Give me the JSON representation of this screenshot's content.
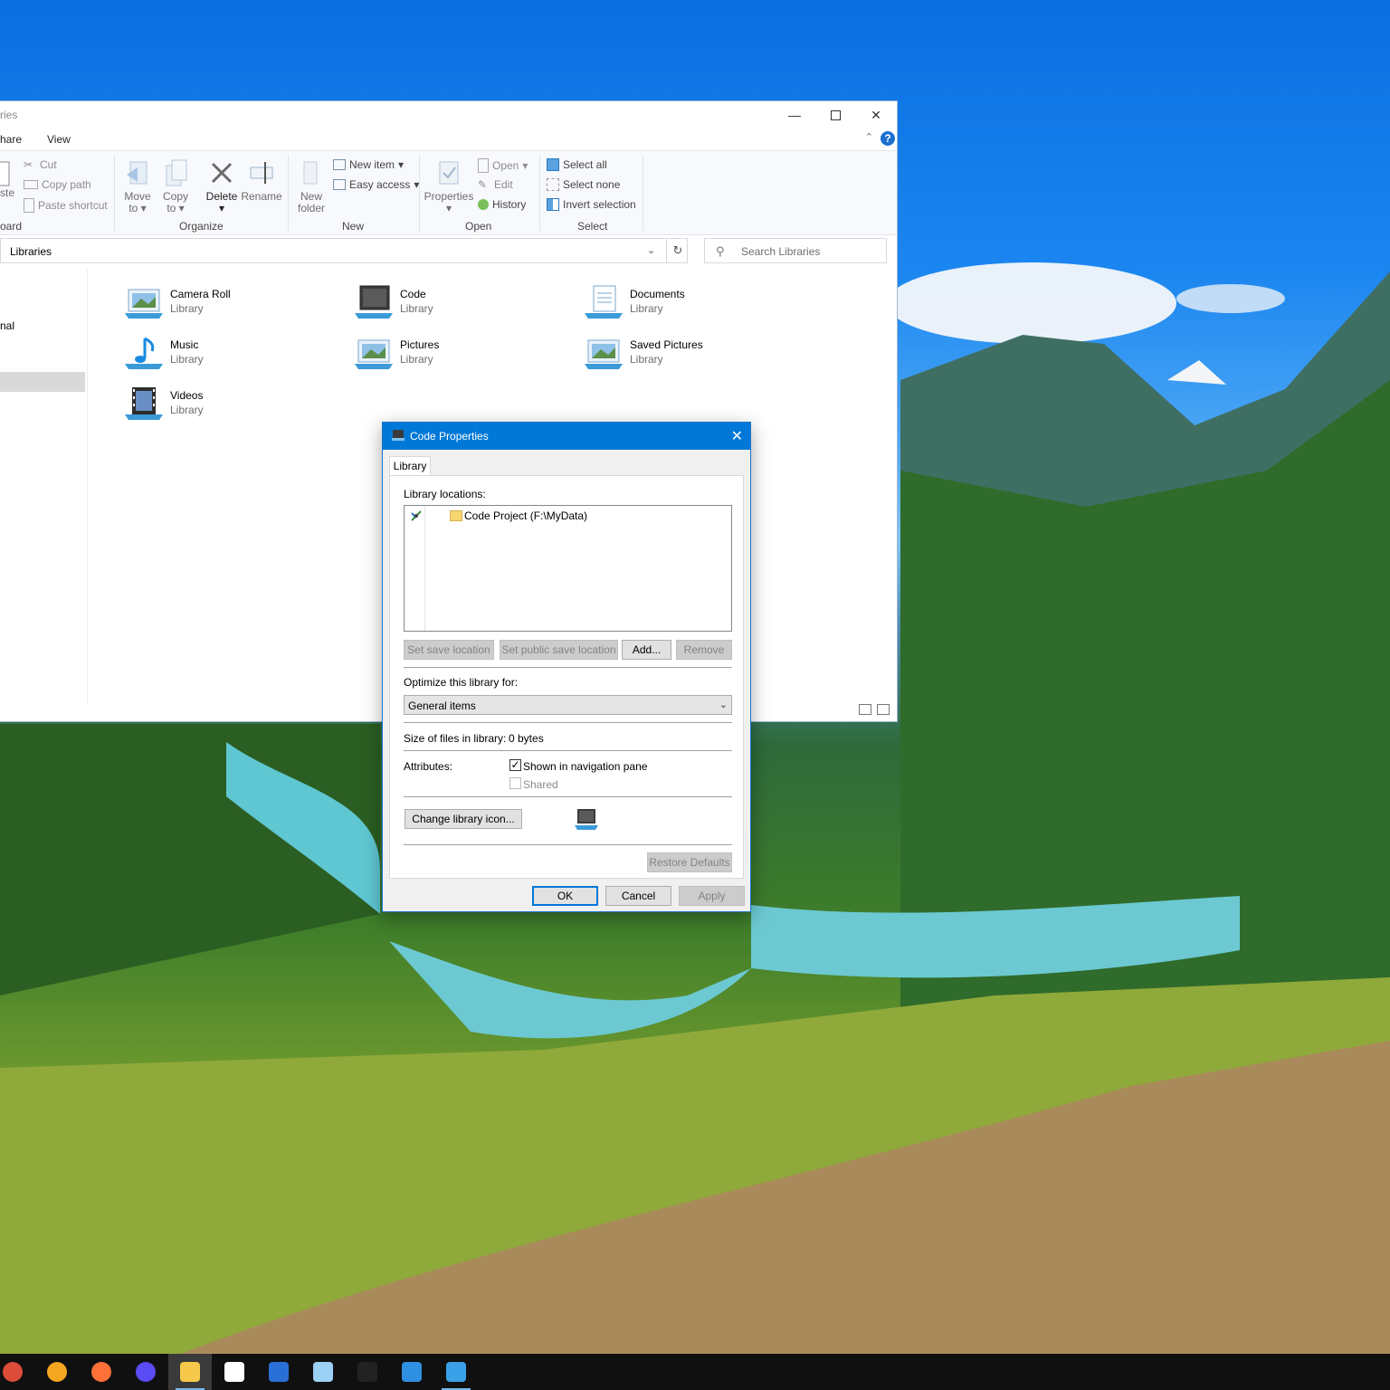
{
  "explorer": {
    "title_fragment": "ries",
    "menu": {
      "share": "hare",
      "view": "View"
    },
    "ribbon": {
      "clipboard": {
        "paste_fragment": "ste",
        "cut": "Cut",
        "copy_path": "Copy path",
        "paste_shortcut": "Paste shortcut",
        "label_fragment": "oard"
      },
      "organize": {
        "move_to": [
          "Move",
          "to"
        ],
        "copy_to": [
          "Copy",
          "to"
        ],
        "delete": "Delete",
        "rename": "Rename",
        "label": "Organize"
      },
      "new": {
        "new_folder": [
          "New",
          "folder"
        ],
        "new_item": "New item",
        "easy_access": "Easy access",
        "label": "New"
      },
      "open": {
        "properties": "Properties",
        "open": "Open",
        "edit": "Edit",
        "history": "History",
        "label": "Open"
      },
      "select": {
        "select_all": "Select all",
        "select_none": "Select none",
        "invert_selection": "Invert selection",
        "label": "Select"
      }
    },
    "address": {
      "path": "Libraries"
    },
    "search": {
      "placeholder": "Search Libraries"
    },
    "nav": {
      "item_fragment": "nal"
    },
    "libraries": [
      {
        "name": "Camera Roll",
        "type": "Library",
        "icon": "pictures-library-icon"
      },
      {
        "name": "Code",
        "type": "Library",
        "icon": "monitor-library-icon"
      },
      {
        "name": "Documents",
        "type": "Library",
        "icon": "documents-library-icon"
      },
      {
        "name": "Music",
        "type": "Library",
        "icon": "music-library-icon"
      },
      {
        "name": "Pictures",
        "type": "Library",
        "icon": "pictures-library-icon"
      },
      {
        "name": "Saved Pictures",
        "type": "Library",
        "icon": "pictures-library-icon"
      },
      {
        "name": "Videos",
        "type": "Library",
        "icon": "videos-library-icon"
      }
    ]
  },
  "dialog": {
    "title": "Code Properties",
    "tab": "Library",
    "locations_label": "Library locations:",
    "locations": [
      {
        "name": "Code Project (F:\\MyData)"
      }
    ],
    "buttons": {
      "set_save": "Set save location",
      "set_public_save": "Set public save location",
      "add": "Add...",
      "remove": "Remove",
      "change_icon": "Change library icon...",
      "restore_defaults": "Restore Defaults",
      "ok": "OK",
      "cancel": "Cancel",
      "apply": "Apply"
    },
    "optimize_label": "Optimize this library for:",
    "optimize_value": "General items",
    "size_label": "Size of files in library:",
    "size_value": "0 bytes",
    "attributes_label": "Attributes:",
    "shown_in_nav": "Shown in navigation pane",
    "shared": "Shared",
    "shown_in_nav_checked": true,
    "shared_checked": false
  },
  "taskbar": {
    "apps": [
      {
        "name": "chrome-icon",
        "color": "#dd4b39"
      },
      {
        "name": "orange-browser-icon",
        "color": "#f5a623"
      },
      {
        "name": "firefox-icon",
        "color": "#ff7139"
      },
      {
        "name": "firefox-nightly-icon",
        "color": "#5a4cf5"
      },
      {
        "name": "file-explorer-icon",
        "color": "#f6c94a"
      },
      {
        "name": "store-icon",
        "color": "#ffffff"
      },
      {
        "name": "powershell-icon",
        "color": "#2a6fd6"
      },
      {
        "name": "notepad-icon",
        "color": "#9bd1f5"
      },
      {
        "name": "terminal-icon",
        "color": "#222222"
      },
      {
        "name": "photos-icon",
        "color": "#2f8fe0"
      },
      {
        "name": "monitor-app-icon",
        "color": "#3aa0e8"
      }
    ]
  }
}
